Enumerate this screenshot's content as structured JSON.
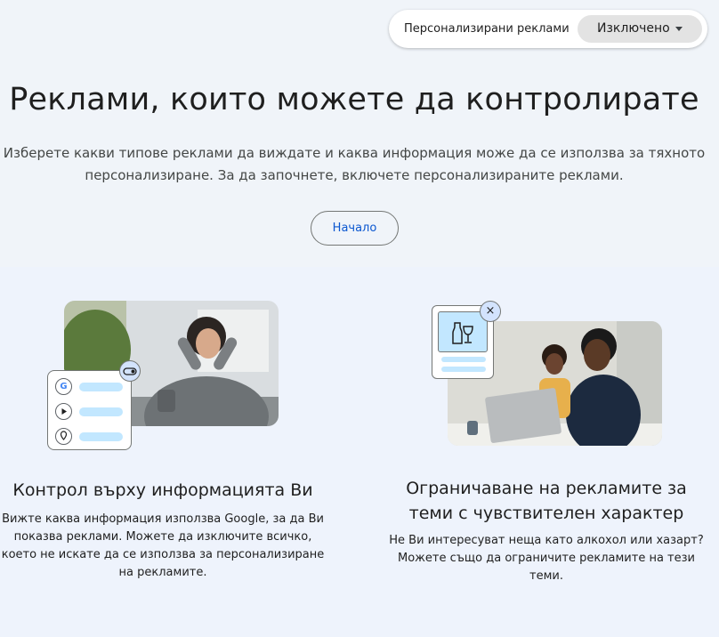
{
  "topbar": {
    "label": "Персонализирани реклами",
    "selected": "Изключено"
  },
  "hero": {
    "title": "Реклами, които можете да контролирате",
    "subtitle_line1": "Изберете какви типове реклами да виждате и каква информация може да се използва за тяхното",
    "subtitle_line2": "персонализиране. За да започнете, включете персонализираните реклами.",
    "start_button": "Начало"
  },
  "cards": [
    {
      "title": "Контрол върху информацията Ви",
      "text_lines": [
        "Вижте каква информация използва Google, за да Ви",
        "показва реклами. Можете да изключите всичко,",
        "което не искате да се използва за персонализиране",
        "на рекламите."
      ]
    },
    {
      "title_line1": "Ограничаване на рекламите за",
      "title_line2": "теми с чувствителен характер",
      "text_lines": [
        "Не Ви интересуват неща като алкохол или хазарт?",
        "Можете също да ограничите рекламите на тези",
        "теми."
      ]
    }
  ],
  "icons": {
    "google": "G",
    "close": "×"
  },
  "colors": {
    "accent": "#0b57d0",
    "chip": "#c2e7ff",
    "badge": "#d3e3fd"
  }
}
